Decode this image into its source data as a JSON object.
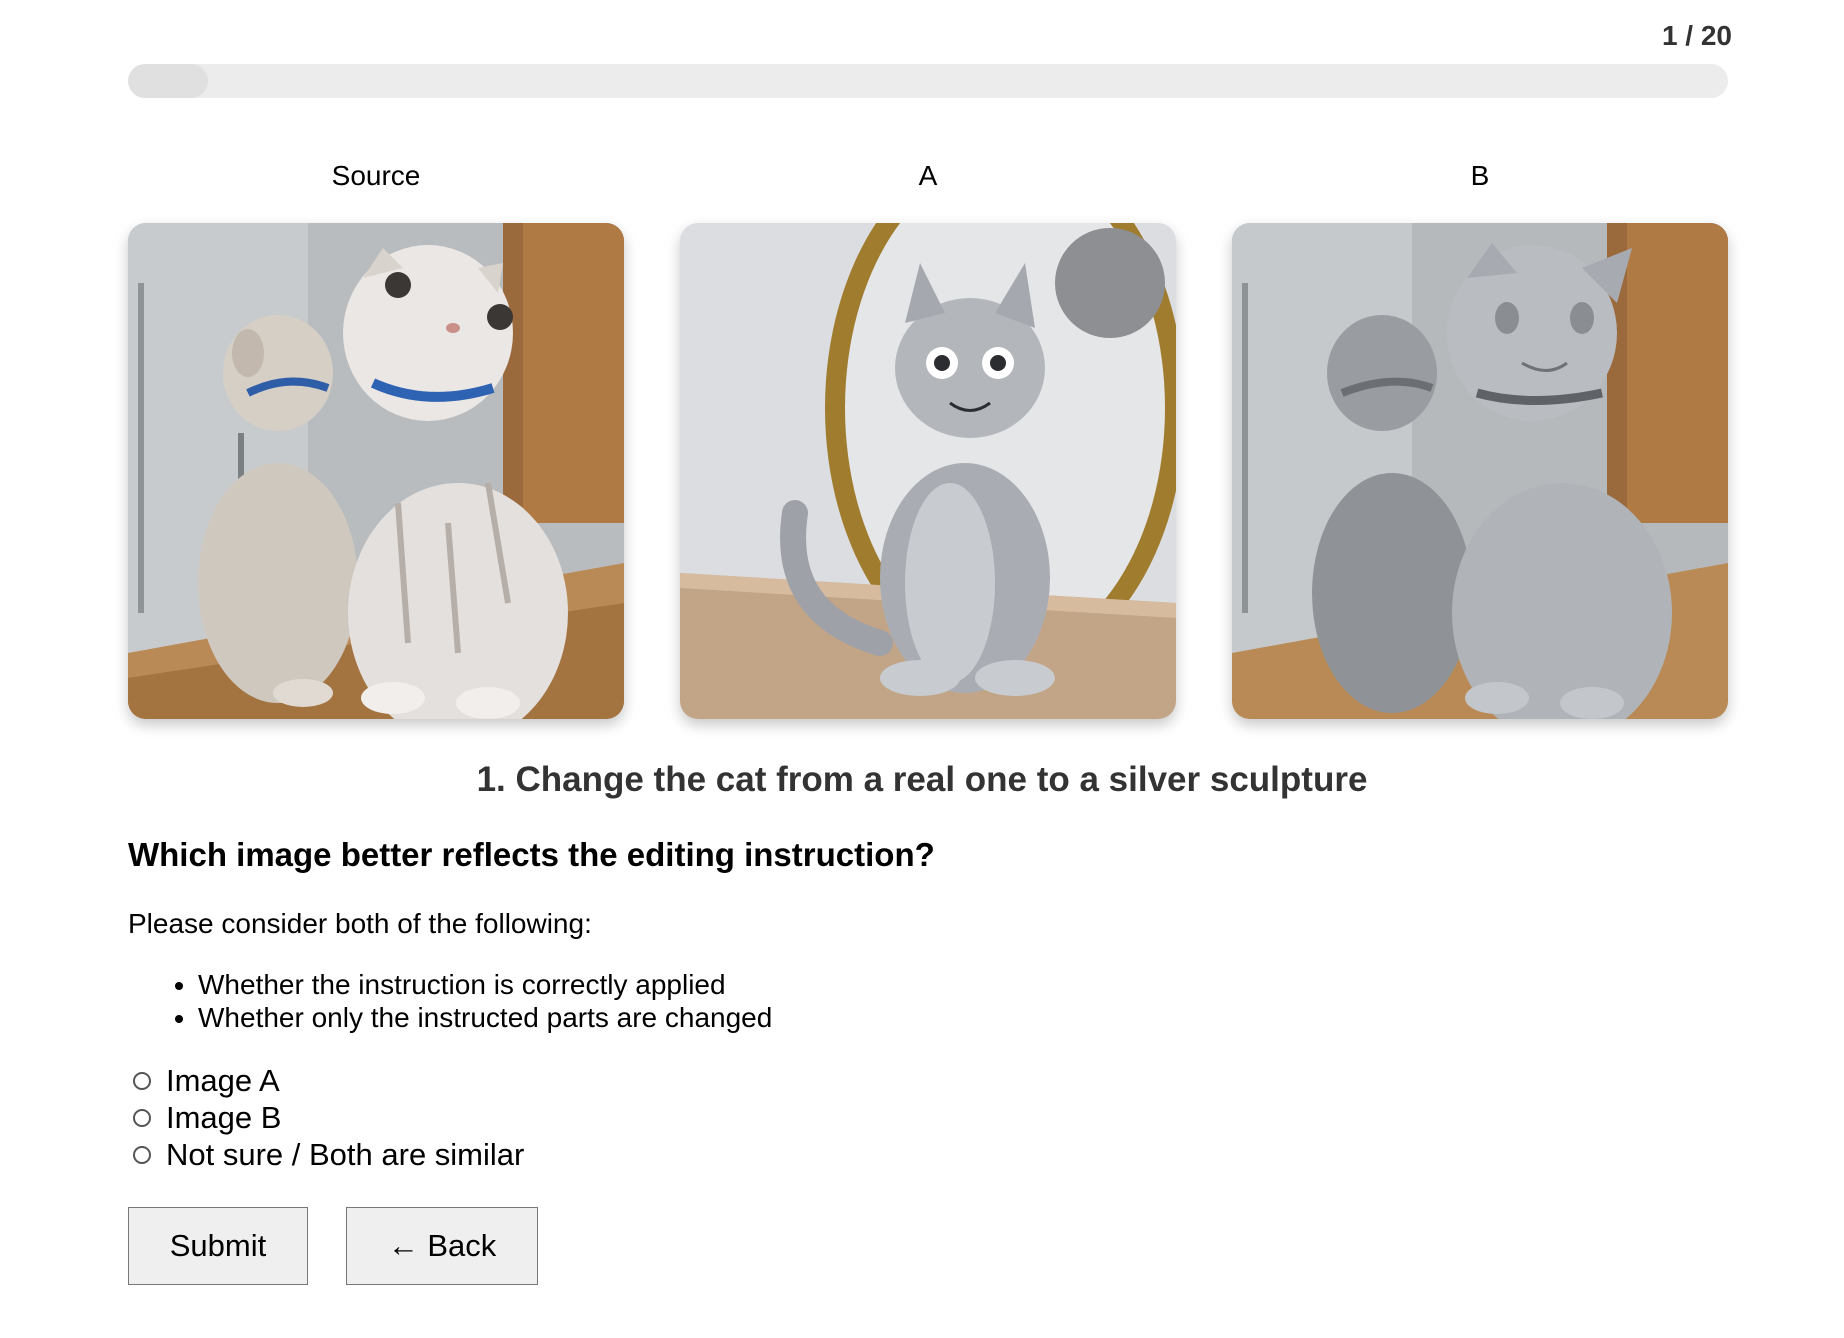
{
  "progress": {
    "text": "1 / 20",
    "current": 1,
    "total": 20,
    "fraction": 0.05
  },
  "columns": {
    "source_label": "Source",
    "a_label": "A",
    "b_label": "B"
  },
  "images": {
    "source": {
      "description_icon": "photo-two-cats-in-bathroom"
    },
    "a": {
      "description_icon": "photo-silver-cat-sculpture-mirror"
    },
    "b": {
      "description_icon": "photo-two-silver-cat-sculptures-bathroom"
    }
  },
  "instruction": "1. Change the cat from a real one to a silver sculpture",
  "question": "Which image better reflects the editing instruction?",
  "consider_text": "Please consider both of the following:",
  "criteria": [
    "Whether the instruction is correctly applied",
    "Whether only the instructed parts are changed"
  ],
  "options": [
    {
      "label": "Image A",
      "selected": false
    },
    {
      "label": "Image B",
      "selected": false
    },
    {
      "label": "Not sure / Both are similar",
      "selected": false
    }
  ],
  "buttons": {
    "submit": "Submit",
    "back": "← Back"
  }
}
